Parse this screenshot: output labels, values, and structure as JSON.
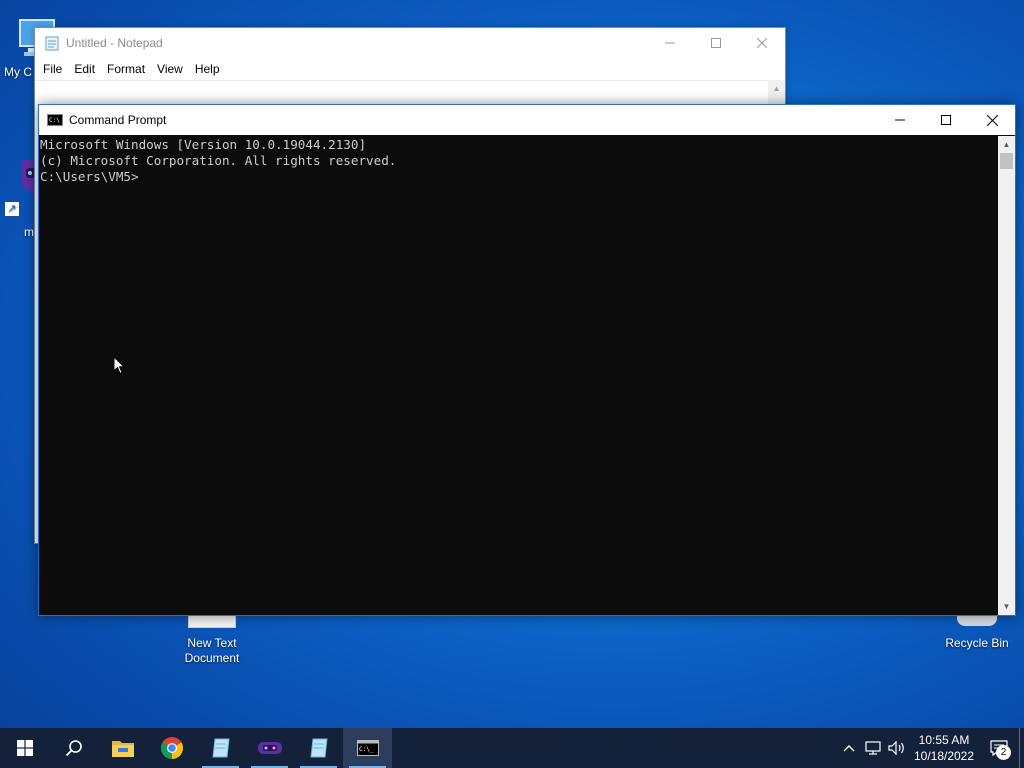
{
  "desktop": {
    "icons": [
      {
        "label": "My C"
      },
      {
        "label": "m"
      },
      {
        "label": "New Text Document"
      },
      {
        "label": "Recycle Bin"
      }
    ]
  },
  "notepad": {
    "title": "Untitled - Notepad",
    "menu": [
      "File",
      "Edit",
      "Format",
      "View",
      "Help"
    ]
  },
  "cmd": {
    "title": "Command Prompt",
    "lines": [
      "Microsoft Windows [Version 10.0.19044.2130]",
      "(c) Microsoft Corporation. All rights reserved.",
      "C:\\Users\\VM5>"
    ]
  },
  "taskbar": {
    "apps": [
      {
        "icon": "start-icon"
      },
      {
        "icon": "search-icon"
      },
      {
        "icon": "file-explorer-icon"
      },
      {
        "icon": "chrome-icon"
      },
      {
        "icon": "notepad-icon"
      },
      {
        "icon": "game-app-icon"
      },
      {
        "icon": "notepad-icon"
      },
      {
        "icon": "command-prompt-icon"
      }
    ],
    "clock": {
      "time": "10:55 AM",
      "date": "10/18/2022"
    },
    "notifications_count": "2"
  },
  "colors": {
    "accent": "#2b6cc4",
    "console_bg": "#0c0c0c",
    "console_fg": "#cccccc",
    "taskbar_bg": "#14213a"
  }
}
